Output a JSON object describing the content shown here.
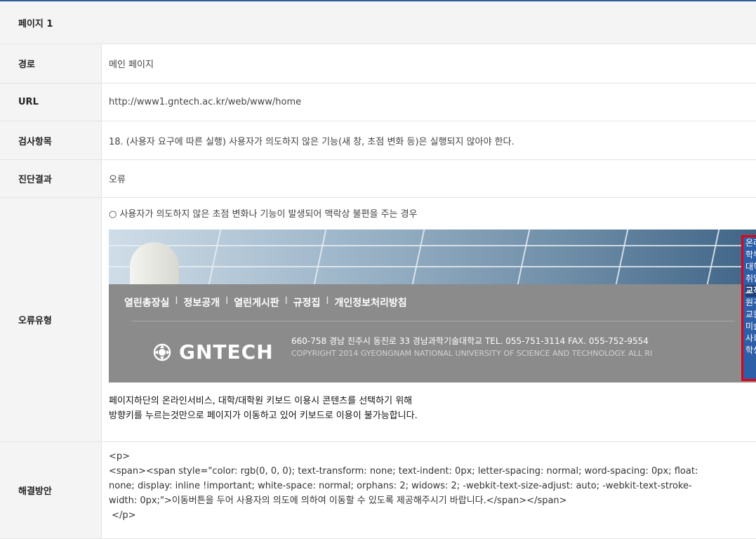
{
  "page_title": "페이지 1",
  "rows": {
    "path": {
      "label": "경로",
      "value": "메인 페이지"
    },
    "url": {
      "label": "URL",
      "value": "http://www1.gntech.ac.kr/web/www/home"
    },
    "item": {
      "label": "검사항목",
      "value": "18. (사용자 요구에 따른 실행) 사용자가 의도하지 않은 기능(새 창, 초점 변화 등)은 실행되지 않아야 한다."
    },
    "result": {
      "label": "진단결과",
      "value": "오류"
    },
    "error": {
      "label": "오류유형",
      "summary": "○ 사용자가 의도하지 않은 초점 변화나 기능이 발생되어 맥락상 불편을 주는 경우",
      "description_line1": "페이지하단의 온라인서비스, 대학/대학원 키보드 이용시 콘텐츠를 선택하기 위해",
      "description_line2": "방향키를 누르는것만으로 페이지가 이동하고 있어 키보드로 이용이 불가능합니다."
    },
    "fix": {
      "label": "해결방안",
      "line1": "<p>",
      "line2": "<span><span style=\"color: rgb(0, 0, 0); text-transform: none; text-indent: 0px; letter-spacing: normal; word-spacing: 0px; float:",
      "line3": "none; display: inline !important; white-space: normal; orphans: 2; widows: 2; -webkit-text-size-adjust: auto; -webkit-text-stroke-",
      "line4": "width: 0px;\">이동버튼을 두어 사용자의 의도에 의하여 이동할 수 있도록 제공해주시기 바랍니다.</span></span>",
      "line5": " </p>"
    }
  },
  "screenshot": {
    "footer_links": [
      "열린총장실",
      "정보공개",
      "열린게시판",
      "규정집",
      "개인정보처리방침"
    ],
    "separator": "I",
    "logo_text": "GNTECH",
    "address": "660-758 경남 진주시 동진로 33 경남과학기술대학교  TEL. 055-751-3114  FAX. 055-752-9554",
    "copyright": "COPYRIGHT 2014 GYEONGNAM NATIONAL UNIVERSITY OF SCIENCE AND TECHNOLOGY. ALL RI",
    "popup_items": [
      "온라",
      "학부",
      "대학",
      "취업",
      "교직",
      "원격",
      "교원",
      "미술",
      "사회",
      "학생"
    ],
    "colors": {
      "popup_bg": "#2d5fa8",
      "popup_border": "#e60012",
      "footer_bg": "#8b8b8b"
    }
  }
}
